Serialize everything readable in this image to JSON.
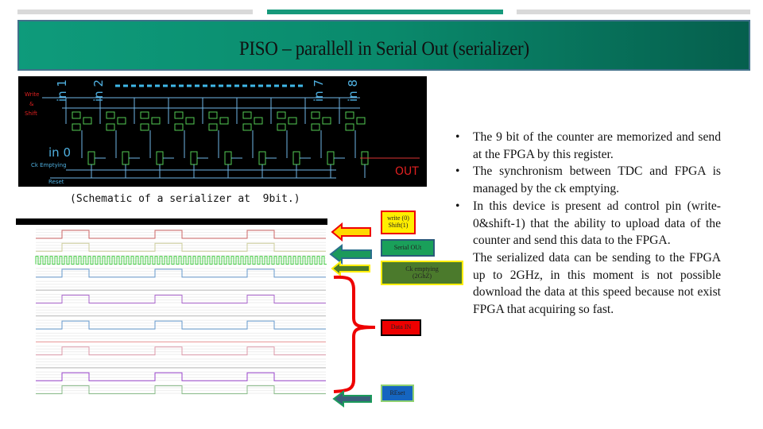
{
  "progress_bars": {
    "colors": [
      "#d9d9d9",
      "#16997b",
      "#d9d9d9"
    ],
    "active_index": 1
  },
  "title": "PISO – parallell in Serial Out (serializer)",
  "schematic": {
    "inputs": [
      "in 1",
      "in 2",
      "in 7",
      "in 8"
    ],
    "in0": "in 0",
    "write_shift": [
      "Write",
      "&",
      "Shift"
    ],
    "ck_emptying": "Ck Emptying",
    "reset": "Reset",
    "out": "OUT"
  },
  "caption": "(Schematic of a serializer at  9bit.)",
  "annotations": {
    "write_shift": [
      "write (0)",
      "Shift(1)"
    ],
    "serial_out": "Serial  OUt",
    "ck_emptying": [
      "Ck emptying",
      "(2GhZ)"
    ],
    "data_in": "Data IN",
    "reset": "REset"
  },
  "colors": {
    "title_start": "#0e9b7b",
    "title_end": "#055f4d",
    "schematic_bg": "#000000",
    "schematic_wire": "#6fb6e6",
    "label_red": "#e02020"
  },
  "bullets": [
    "The 9 bit of the counter are memorized and send at the FPGA by this register.",
    "The synchronism  between TDC and FPGA is managed by the ck emptying.",
    " In this device is present ad control pin (write-0&shift-1) that  the ability to upload data of the counter  and send this data to the FPGA."
  ],
  "paragraph": "The serialized data can be sending to the FPGA up to 2GHz, in this moment is not possible download the data at this speed because not exist FPGA that acquiring so fast."
}
